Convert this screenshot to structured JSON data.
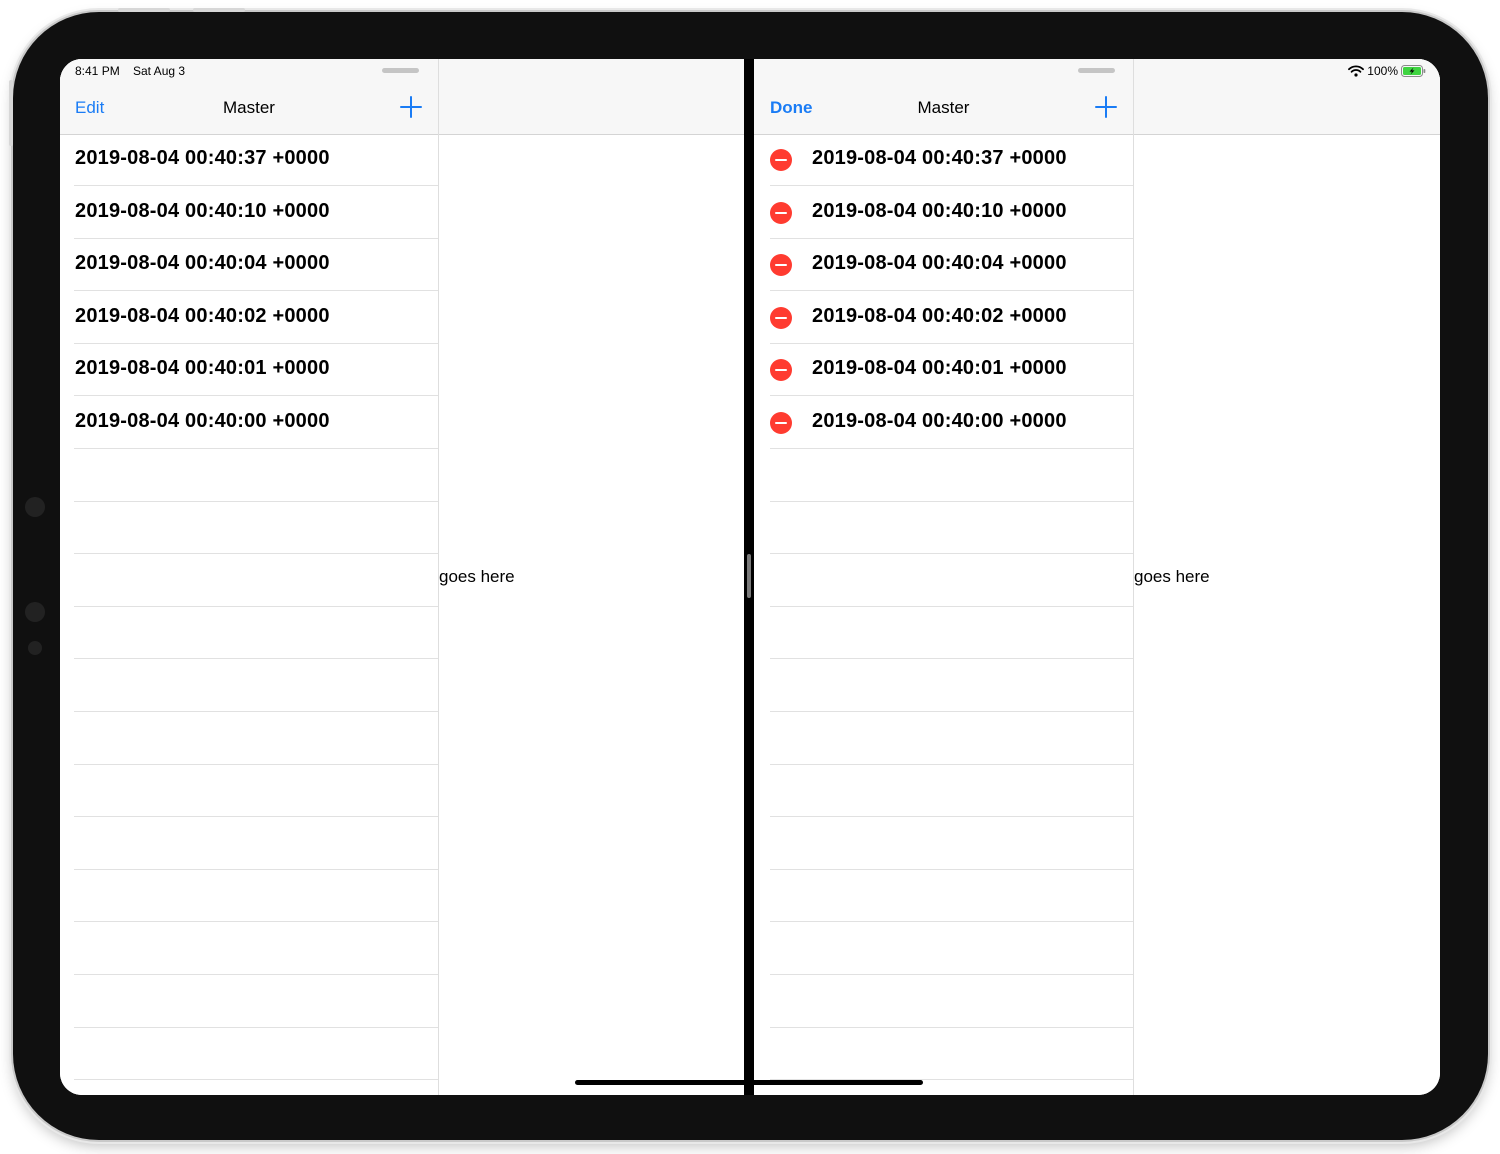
{
  "status_bar": {
    "time": "8:41 PM",
    "date": "Sat Aug 3",
    "battery_percent": "100%",
    "battery_level": 1.0
  },
  "left_app": {
    "nav": {
      "edit_label": "Edit",
      "title": "Master",
      "add_icon": "plus-icon"
    },
    "rows": [
      "2019-08-04 00:40:37 +0000",
      "2019-08-04 00:40:10 +0000",
      "2019-08-04 00:40:04 +0000",
      "2019-08-04 00:40:02 +0000",
      "2019-08-04 00:40:01 +0000",
      "2019-08-04 00:40:00 +0000"
    ],
    "detail_text": "goes here"
  },
  "right_app": {
    "nav": {
      "done_label": "Done",
      "title": "Master",
      "add_icon": "plus-icon"
    },
    "rows": [
      "2019-08-04 00:40:37 +0000",
      "2019-08-04 00:40:10 +0000",
      "2019-08-04 00:40:04 +0000",
      "2019-08-04 00:40:02 +0000",
      "2019-08-04 00:40:01 +0000",
      "2019-08-04 00:40:00 +0000"
    ],
    "row_delete_icon": "minus-circle-icon",
    "detail_text": "goes here"
  },
  "colors": {
    "tint": "#1a7cf5",
    "delete": "#ff3b30",
    "battery": "#3fd441",
    "navbar_bg": "#f7f7f7",
    "separator": "#e1e1e1"
  }
}
